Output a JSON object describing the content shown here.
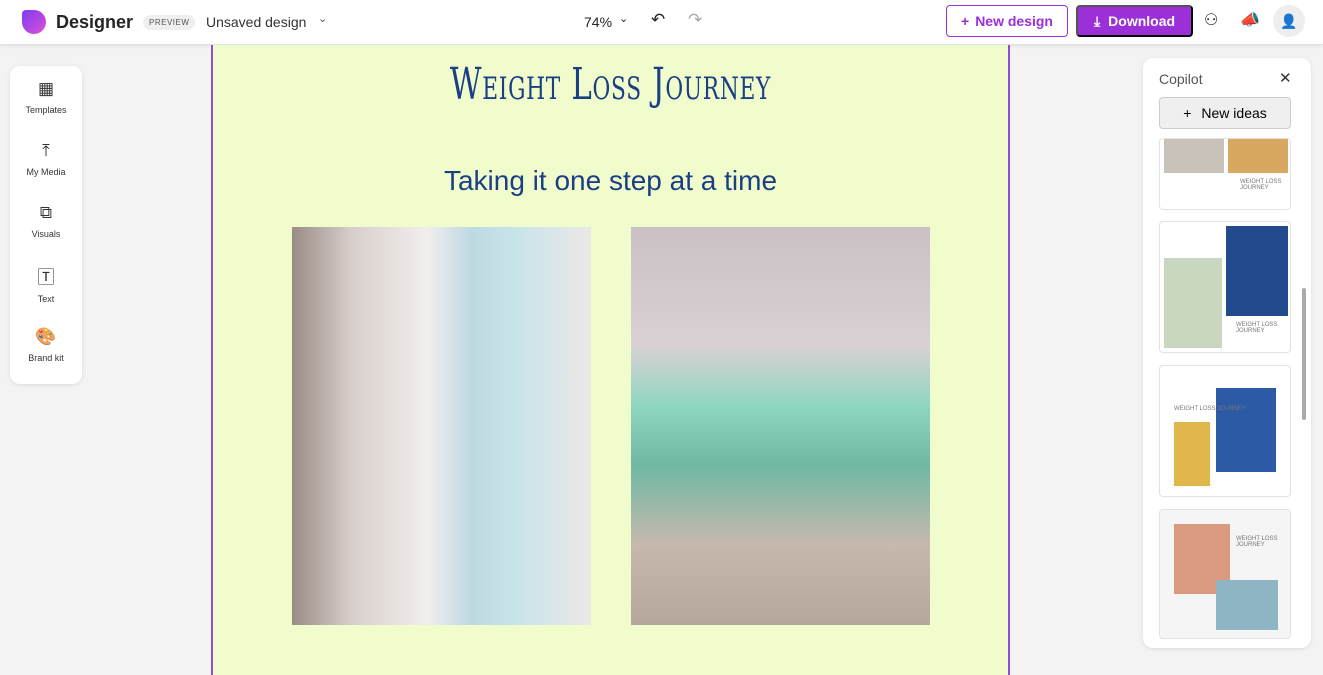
{
  "header": {
    "app_name": "Designer",
    "badge": "PREVIEW",
    "design_name": "Unsaved design",
    "zoom": "74%",
    "new_design": "New design",
    "download": "Download"
  },
  "sidebar": {
    "items": [
      {
        "label": "Templates",
        "icon": "templates-icon"
      },
      {
        "label": "My Media",
        "icon": "upload-icon"
      },
      {
        "label": "Visuals",
        "icon": "visuals-icon"
      },
      {
        "label": "Text",
        "icon": "text-icon"
      },
      {
        "label": "Brand kit",
        "icon": "palette-icon"
      }
    ]
  },
  "canvas": {
    "title": "Weight Loss Journey",
    "subtitle": "Taking it one step at a time"
  },
  "copilot": {
    "title": "Copilot",
    "new_ideas": "New ideas",
    "thumbs": [
      "WEIGHT LOSS JOURNEY",
      "WEIGHT LOSS JOURNEY",
      "WEIGHT LOSS JOURNEY",
      "WEIGHT LOSS JOURNEY"
    ]
  },
  "colors": {
    "accent": "#9b30d9",
    "canvas_bg": "#f1fccc",
    "title": "#1b3f85"
  }
}
